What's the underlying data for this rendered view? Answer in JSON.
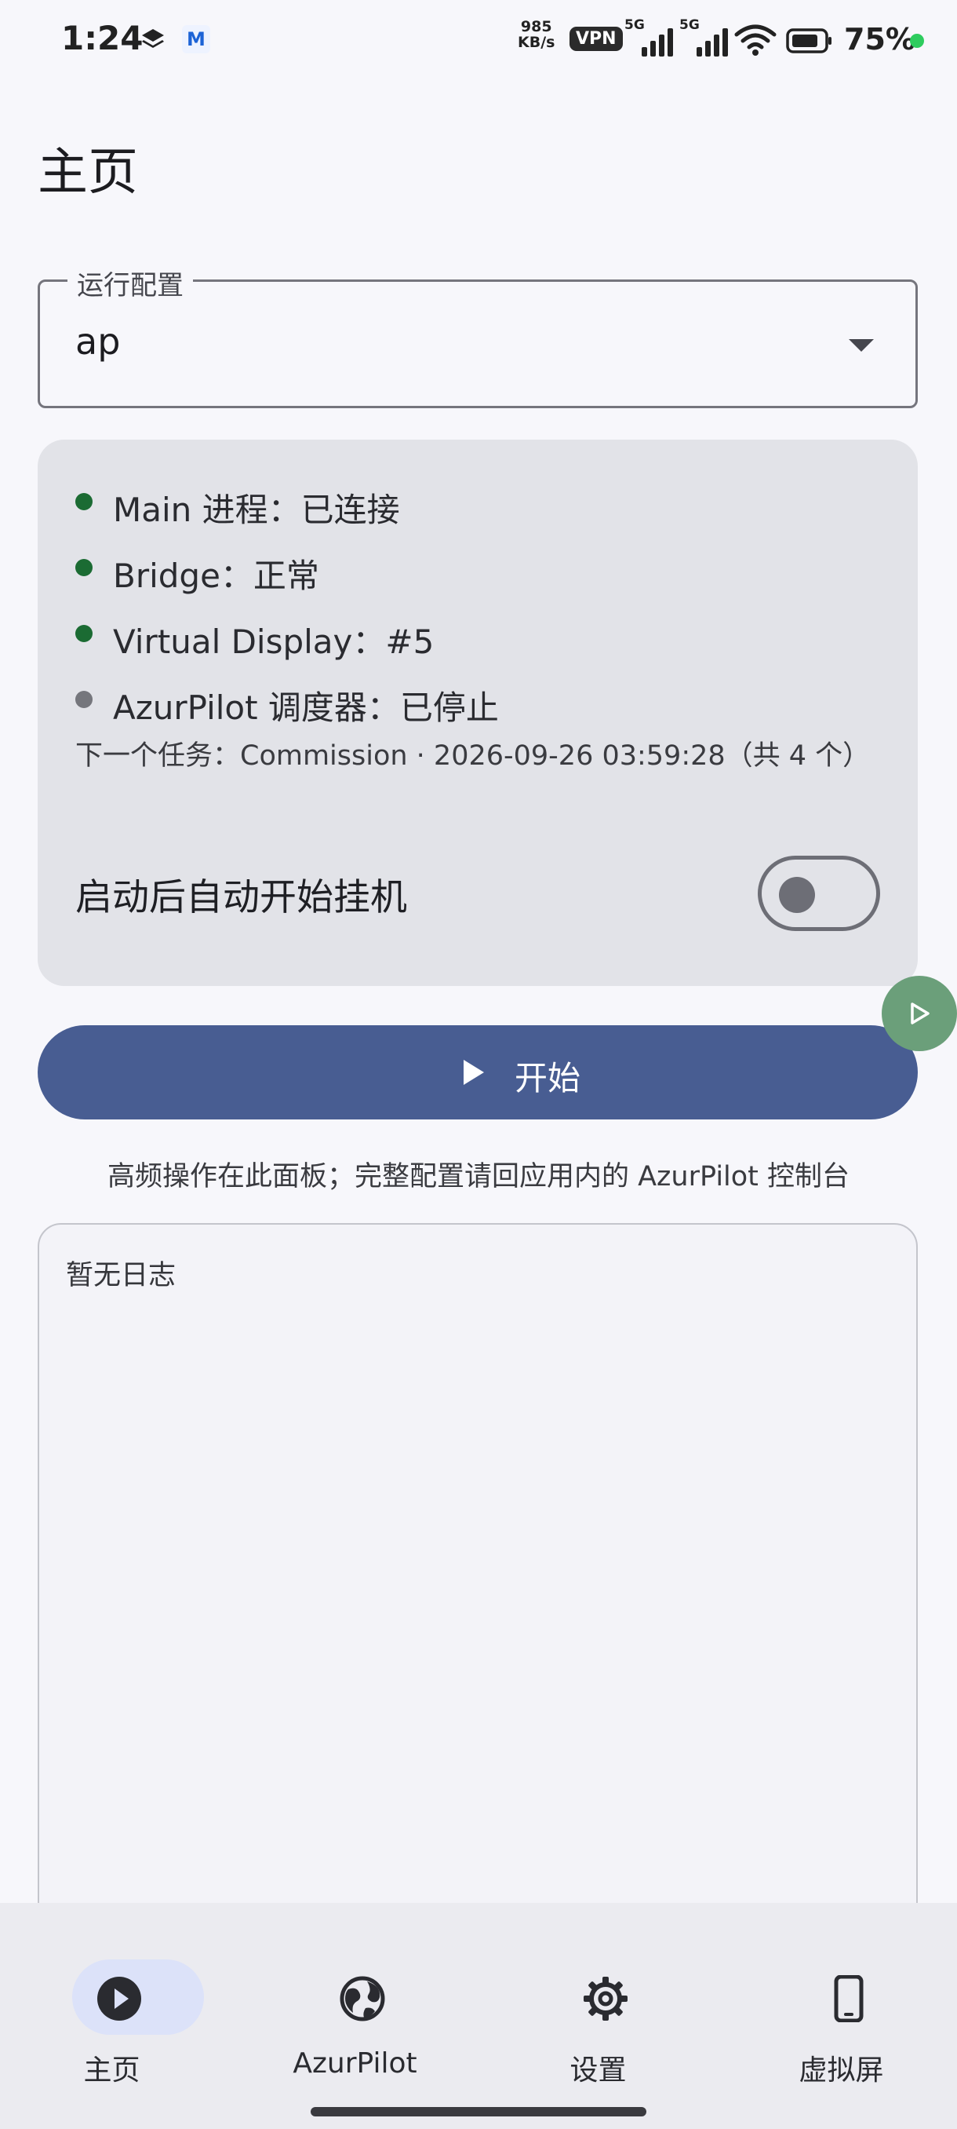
{
  "status_bar": {
    "time": "1:24",
    "net_speed_value": "985",
    "net_speed_unit": "KB/s",
    "vpn": "VPN",
    "signal1": "5G",
    "signal2": "5G",
    "battery_percent": "75%",
    "app_notification": "M"
  },
  "page": {
    "title": "主页"
  },
  "run_config": {
    "label": "运行配置",
    "value": "ap"
  },
  "status_card": {
    "rows": [
      {
        "text": "Main 进程：已连接",
        "color": "#1b6b33"
      },
      {
        "text": "Bridge：正常",
        "color": "#1b6b33"
      },
      {
        "text": "Virtual Display：#5",
        "color": "#1b6b33"
      },
      {
        "text": "AzurPilot 调度器：已停止",
        "color": "#75767c"
      }
    ],
    "next_task": "下一个任务：Commission · 2026-09-26 03:59:28（共 4 个）",
    "auto_start_label": "启动后自动开始挂机",
    "auto_start_enabled": false
  },
  "start_button": {
    "label": "开始"
  },
  "hint": "高频操作在此面板；完整配置请回应用内的 AzurPilot 控制台",
  "log": {
    "empty_text": "暂无日志"
  },
  "bottom_nav": {
    "items": [
      {
        "label": "主页",
        "icon": "play-circle-icon",
        "active": true
      },
      {
        "label": "AzurPilot",
        "icon": "globe-icon",
        "active": false
      },
      {
        "label": "设置",
        "icon": "gear-icon",
        "active": false
      },
      {
        "label": "虚拟屏",
        "icon": "phone-icon",
        "active": false
      }
    ]
  },
  "colors": {
    "primary": "#485d92",
    "background": "#f7f7fb",
    "card": "#e2e3e8",
    "nav_active": "#dce2f9",
    "connected": "#1b6b33",
    "stopped": "#75767c"
  }
}
